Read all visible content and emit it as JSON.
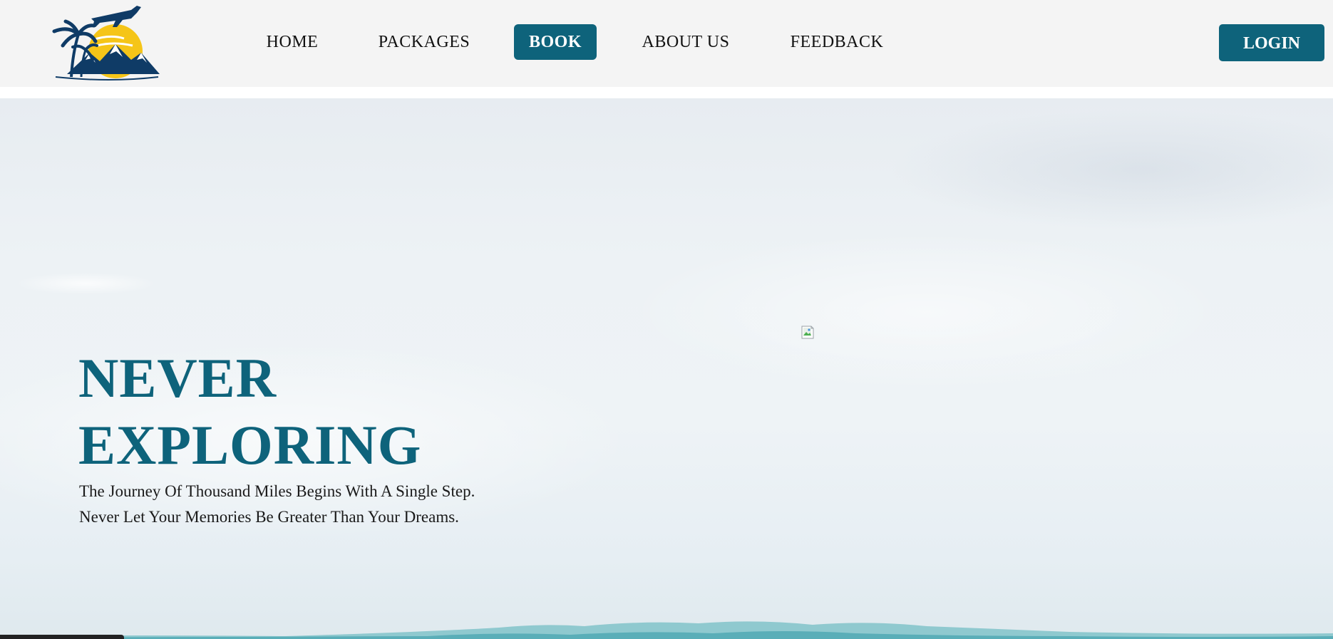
{
  "nav": {
    "items": [
      {
        "label": "HOME",
        "active": false
      },
      {
        "label": "PACKAGES",
        "active": false
      },
      {
        "label": "BOOK",
        "active": true
      },
      {
        "label": "ABOUT US",
        "active": false
      },
      {
        "label": "FEEDBACK",
        "active": false
      }
    ],
    "login_label": "LOGIN",
    "logo_icon": "travel-logo-icon"
  },
  "hero": {
    "title_line1": "NEVER",
    "title_line2": "EXPLORING",
    "subtitle_line1": "The Journey Of Thousand Miles Begins With A Single Step.",
    "subtitle_line2": "Never Let Your Memories Be Greater Than Your Dreams.",
    "image_icon": "broken-image-icon"
  },
  "colors": {
    "accent": "#0e637b",
    "navbar_bg": "#f4f4f4",
    "logo_navy": "#0f3b66",
    "logo_sun": "#f5c518"
  }
}
